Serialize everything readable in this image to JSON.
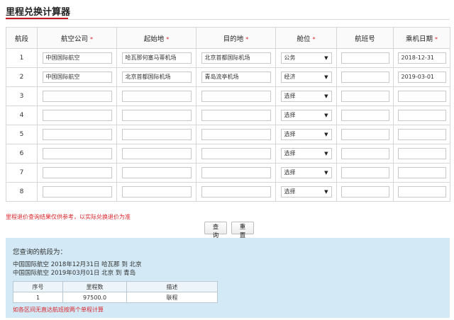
{
  "title": "里程兑换计算器",
  "table": {
    "headers": {
      "segment": "航段",
      "airline": "航空公司",
      "origin": "起始地",
      "destination": "目的地",
      "cabin": "舱位",
      "flight_no": "航班号",
      "date": "乘机日期"
    },
    "required_mark": "*",
    "rows": [
      {
        "no": "1",
        "airline": "中国国际航空",
        "origin": "哈瓦那何塞马蒂机场",
        "destination": "北京首都国际机场",
        "cabin": "公务",
        "flight_no": "",
        "date": "2018-12-31"
      },
      {
        "no": "2",
        "airline": "中国国际航空",
        "origin": "北京首都国际机场",
        "destination": "青岛流亭机场",
        "cabin": "经济",
        "flight_no": "",
        "date": "2019-03-01"
      },
      {
        "no": "3",
        "airline": "",
        "origin": "",
        "destination": "",
        "cabin": "选择",
        "flight_no": "",
        "date": ""
      },
      {
        "no": "4",
        "airline": "",
        "origin": "",
        "destination": "",
        "cabin": "选择",
        "flight_no": "",
        "date": ""
      },
      {
        "no": "5",
        "airline": "",
        "origin": "",
        "destination": "",
        "cabin": "选择",
        "flight_no": "",
        "date": ""
      },
      {
        "no": "6",
        "airline": "",
        "origin": "",
        "destination": "",
        "cabin": "选择",
        "flight_no": "",
        "date": ""
      },
      {
        "no": "7",
        "airline": "",
        "origin": "",
        "destination": "",
        "cabin": "选择",
        "flight_no": "",
        "date": ""
      },
      {
        "no": "8",
        "airline": "",
        "origin": "",
        "destination": "",
        "cabin": "选择",
        "flight_no": "",
        "date": ""
      }
    ]
  },
  "note_top": "里程退价查询结果仅供参考，以实际兑换退价为准",
  "buttons": {
    "query": "查询",
    "reset": "重置"
  },
  "result": {
    "heading": "您查询的航段为：",
    "segments": [
      "中国国际航空 2018年12月31日 哈瓦那 到 北京",
      "中国国际航空 2019年03月01日 北京 到 青岛"
    ],
    "table_headers": {
      "no": "序号",
      "miles": "里程数",
      "desc": "描述"
    },
    "table_rows": [
      {
        "no": "1",
        "miles": "97500.0",
        "desc": "联程"
      }
    ],
    "note": "如各区间无直达航班按两个单程计算"
  },
  "colors": {
    "accent": "#c4161c",
    "required": "#d9242b",
    "result_bg": "#d3eaf6"
  }
}
